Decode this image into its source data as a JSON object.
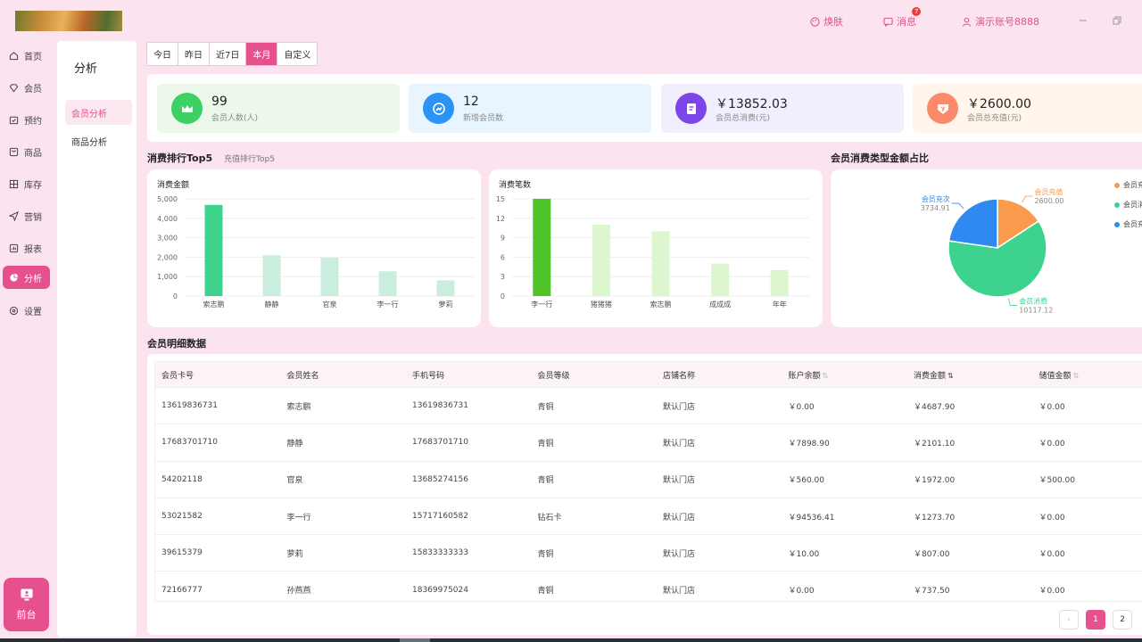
{
  "topbar": {
    "skin_label": "焕肤",
    "message_label": "消息",
    "message_badge": "7",
    "account_label": "演示账号8888"
  },
  "nav": {
    "items": [
      {
        "label": "首页",
        "icon": "home-icon"
      },
      {
        "label": "会员",
        "icon": "diamond-icon"
      },
      {
        "label": "预约",
        "icon": "calendar-icon"
      },
      {
        "label": "商品",
        "icon": "box-icon"
      },
      {
        "label": "库存",
        "icon": "storage-icon"
      },
      {
        "label": "营销",
        "icon": "send-icon"
      },
      {
        "label": "报表",
        "icon": "report-icon"
      },
      {
        "label": "分析",
        "icon": "pie-icon",
        "active": true
      },
      {
        "label": "设置",
        "icon": "settings-icon"
      }
    ],
    "front_label": "前台"
  },
  "subnav": {
    "title": "分析",
    "items": [
      {
        "label": "会员分析",
        "active": true
      },
      {
        "label": "商品分析"
      }
    ]
  },
  "date_tabs": [
    "今日",
    "昨日",
    "近7日",
    "本月",
    "自定义"
  ],
  "date_tab_active": "本月",
  "stats": [
    {
      "value": "99",
      "label": "会员人数(人)",
      "bg": "#ecf9ea",
      "icon_bg": "#3dd163",
      "icon": "crown-icon"
    },
    {
      "value": "12",
      "label": "新增会员数",
      "bg": "#e9f5fe",
      "icon_bg": "#2b93f5",
      "icon": "trend-icon"
    },
    {
      "value": "￥13852.03",
      "label": "会员总消费(元)",
      "bg": "#f1eefe",
      "icon_bg": "#7b45e8",
      "icon": "receipt-icon"
    },
    {
      "value": "￥2600.00",
      "label": "会员总充值(元)",
      "bg": "#fff5ea",
      "icon_bg": "#fb8a6b",
      "icon": "wallet-icon"
    }
  ],
  "ranking": {
    "title": "消费排行Top5",
    "alt_tab": "充值排行Top5"
  },
  "pie_section_title": "会员消费类型金额占比",
  "table_title": "会员明细数据",
  "chart_data": [
    {
      "type": "bar",
      "title": "消费金额",
      "categories": [
        "索志鹏",
        "静静",
        "官泉",
        "李一行",
        "萝莉"
      ],
      "values": [
        4687.9,
        2101.1,
        1972.0,
        1273.7,
        807.0
      ],
      "ylim": [
        0,
        5000
      ],
      "yticks": [
        "0",
        "1,000",
        "2,000",
        "3,000",
        "4,000",
        "5,000"
      ],
      "highlight_color": "#3dd38e",
      "color": "#c9eedd",
      "grid": true
    },
    {
      "type": "bar",
      "title": "消费笔数",
      "categories": [
        "李一行",
        "猪猪猪",
        "索志鹏",
        "成成成",
        "年年"
      ],
      "values": [
        15,
        11,
        10,
        5,
        4
      ],
      "ylim": [
        0,
        15
      ],
      "yticks": [
        "0",
        "3",
        "6",
        "9",
        "12",
        "15"
      ],
      "highlight_color": "#50c22a",
      "color": "#dcf7cf",
      "grid": true
    },
    {
      "type": "pie",
      "slices": [
        {
          "name": "会员充值",
          "value": 2600.0,
          "value_label": "2600.00",
          "color": "#fa9a4c"
        },
        {
          "name": "会员消费",
          "value": 10117.12,
          "value_label": "10117.12",
          "color": "#3dd38e"
        },
        {
          "name": "会员充次",
          "value": 3734.91,
          "value_label": "3734.91",
          "color": "#2e8af0"
        }
      ],
      "legend": [
        "会员充",
        "会员消",
        "会员充"
      ],
      "legend_position": "right"
    }
  ],
  "table": {
    "headers": [
      {
        "label": "会员卡号"
      },
      {
        "label": "会员姓名"
      },
      {
        "label": "手机号码"
      },
      {
        "label": "会员等级"
      },
      {
        "label": "店铺名称"
      },
      {
        "label": "账户余额",
        "sort": "⇅"
      },
      {
        "label": "消费金额",
        "sort": "⇅",
        "sorted": true
      },
      {
        "label": "储值金额",
        "sort": "⇅"
      }
    ],
    "rows": [
      [
        "13619836731",
        "索志鹏",
        "13619836731",
        "青铜",
        "默认门店",
        "￥0.00",
        "￥4687.90",
        "￥0.00"
      ],
      [
        "17683701710",
        "静静",
        "17683701710",
        "青铜",
        "默认门店",
        "￥7898.90",
        "￥2101.10",
        "￥0.00"
      ],
      [
        "54202118",
        "官泉",
        "13685274156",
        "青铜",
        "默认门店",
        "￥560.00",
        "￥1972.00",
        "￥500.00"
      ],
      [
        "53021582",
        "李一行",
        "15717160582",
        "钻石卡",
        "默认门店",
        "￥94536.41",
        "￥1273.70",
        "￥0.00"
      ],
      [
        "39615379",
        "萝莉",
        "15833333333",
        "青铜",
        "默认门店",
        "￥10.00",
        "￥807.00",
        "￥0.00"
      ],
      [
        "72166777",
        "孙燕燕",
        "18369975024",
        "青铜",
        "默认门店",
        "￥0.00",
        "￥737.50",
        "￥0.00"
      ]
    ]
  },
  "pagination": {
    "prev": "‹",
    "pages": [
      "1",
      "2"
    ],
    "current": "1"
  },
  "colors": {
    "accent": "#e6508c",
    "page_bg": "#fbe4ef"
  }
}
